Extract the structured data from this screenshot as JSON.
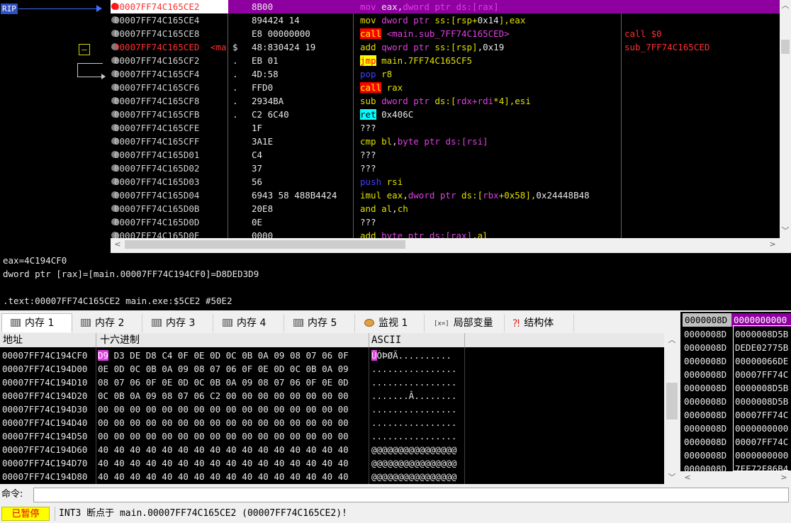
{
  "disasm": {
    "rip_label": "RIP",
    "jump_marker": "—",
    "rows": [
      {
        "addr": "00007FF74C165CE2",
        "label": "",
        "marker": "",
        "bytes": "8B00",
        "current": true,
        "bp": "red",
        "addr_red": true,
        "ins": [
          [
            "mov ",
            "op-mov"
          ],
          [
            "eax",
            "t-w"
          ],
          [
            ",",
            "t-w"
          ],
          [
            "dword ptr ",
            "t-p"
          ],
          [
            "ds:[rax]",
            "t-p"
          ]
        ],
        "comment": ""
      },
      {
        "addr": "00007FF74C165CE4",
        "label": "",
        "marker": "",
        "bytes": "894424 14",
        "current": false,
        "bp": "gray",
        "addr_red": false,
        "ins": [
          [
            "mov ",
            "op-y"
          ],
          [
            "dword ptr ",
            "t-p"
          ],
          [
            "ss:[rsp+",
            "t-y"
          ],
          [
            "0x14",
            "t-w"
          ],
          [
            "],",
            "t-y"
          ],
          [
            "eax",
            "t-y"
          ]
        ],
        "comment": ""
      },
      {
        "addr": "00007FF74C165CE8",
        "label": "",
        "marker": "",
        "bytes": "E8 00000000",
        "current": false,
        "bp": "gray",
        "addr_red": false,
        "ins": [
          [
            "call",
            "op-call"
          ],
          [
            " <main.sub_7FF74C165CED>",
            "t-p"
          ]
        ],
        "comment": "call $0"
      },
      {
        "addr": "00007FF74C165CED",
        "label": "<ma",
        "marker": "$",
        "bytes": "48:830424 19",
        "current": false,
        "bp": "gray",
        "addr_red": true,
        "ins": [
          [
            "add ",
            "op-y"
          ],
          [
            "qword ptr ",
            "t-p"
          ],
          [
            "ss:[rsp]",
            "t-y"
          ],
          [
            ",0x19",
            "t-w"
          ]
        ],
        "comment": "sub_7FF74C165CED"
      },
      {
        "addr": "00007FF74C165CF2",
        "label": "",
        "marker": ".",
        "bytes": "EB 01",
        "current": false,
        "bp": "gray",
        "addr_red": false,
        "ins": [
          [
            "jmp",
            "op-jmp"
          ],
          [
            " main.7FF74C165CF5",
            "t-y"
          ]
        ],
        "comment": ""
      },
      {
        "addr": "00007FF74C165CF4",
        "label": "",
        "marker": ".",
        "bytes": "4D:58",
        "current": false,
        "bp": "gray",
        "addr_red": false,
        "ins": [
          [
            "pop ",
            "op-push"
          ],
          [
            "r8",
            "t-y"
          ]
        ],
        "comment": ""
      },
      {
        "addr": "00007FF74C165CF6",
        "label": "",
        "marker": ".",
        "bytes": "FFD0",
        "current": false,
        "bp": "gray",
        "addr_red": false,
        "ins": [
          [
            "call",
            "op-call"
          ],
          [
            " rax",
            "t-y"
          ]
        ],
        "comment": ""
      },
      {
        "addr": "00007FF74C165CF8",
        "label": "",
        "marker": ".",
        "bytes": "2934BA",
        "current": false,
        "bp": "gray",
        "addr_red": false,
        "ins": [
          [
            "sub ",
            "op-y"
          ],
          [
            "dword ptr ",
            "t-p"
          ],
          [
            "ds:[",
            "t-y"
          ],
          [
            "rdx+rdi",
            "t-p"
          ],
          [
            "*4],",
            "t-y"
          ],
          [
            "esi",
            "t-y"
          ]
        ],
        "comment": ""
      },
      {
        "addr": "00007FF74C165CFB",
        "label": "",
        "marker": ".",
        "bytes": "C2 6C40",
        "current": false,
        "bp": "gray",
        "addr_red": false,
        "ins": [
          [
            "ret",
            "op-ret"
          ],
          [
            " 0x406C",
            "t-w"
          ]
        ],
        "comment": ""
      },
      {
        "addr": "00007FF74C165CFE",
        "label": "",
        "marker": "",
        "bytes": "1F",
        "current": false,
        "bp": "gray",
        "addr_red": false,
        "ins": [
          [
            "???",
            "t-w"
          ]
        ],
        "comment": ""
      },
      {
        "addr": "00007FF74C165CFF",
        "label": "",
        "marker": "",
        "bytes": "3A1E",
        "current": false,
        "bp": "gray",
        "addr_red": false,
        "ins": [
          [
            "cmp ",
            "op-y"
          ],
          [
            "bl",
            "t-y"
          ],
          [
            ",",
            "t-w"
          ],
          [
            "byte ptr ",
            "t-p"
          ],
          [
            "ds:[rsi]",
            "t-p"
          ]
        ],
        "comment": ""
      },
      {
        "addr": "00007FF74C165D01",
        "label": "",
        "marker": "",
        "bytes": "C4",
        "current": false,
        "bp": "gray",
        "addr_red": false,
        "ins": [
          [
            "???",
            "t-w"
          ]
        ],
        "comment": ""
      },
      {
        "addr": "00007FF74C165D02",
        "label": "",
        "marker": "",
        "bytes": "37",
        "current": false,
        "bp": "gray",
        "addr_red": false,
        "ins": [
          [
            "???",
            "t-w"
          ]
        ],
        "comment": ""
      },
      {
        "addr": "00007FF74C165D03",
        "label": "",
        "marker": "",
        "bytes": "56",
        "current": false,
        "bp": "gray",
        "addr_red": false,
        "ins": [
          [
            "push ",
            "op-push"
          ],
          [
            "rsi",
            "t-y"
          ]
        ],
        "comment": ""
      },
      {
        "addr": "00007FF74C165D04",
        "label": "",
        "marker": "",
        "bytes": "6943 58 488B4424",
        "current": false,
        "bp": "gray",
        "addr_red": false,
        "ins": [
          [
            "imul ",
            "op-y"
          ],
          [
            "eax",
            "t-y"
          ],
          [
            ",",
            "t-w"
          ],
          [
            "dword ptr ",
            "t-p"
          ],
          [
            "ds:[",
            "t-y"
          ],
          [
            "rbx",
            "t-p"
          ],
          [
            "+0x58],",
            "t-y"
          ],
          [
            "0x24448B48",
            "t-w"
          ]
        ],
        "comment": ""
      },
      {
        "addr": "00007FF74C165D0B",
        "label": "",
        "marker": "",
        "bytes": "20E8",
        "current": false,
        "bp": "gray",
        "addr_red": false,
        "ins": [
          [
            "and ",
            "op-y"
          ],
          [
            "al",
            "t-y"
          ],
          [
            ",",
            "t-w"
          ],
          [
            "ch",
            "t-y"
          ]
        ],
        "comment": ""
      },
      {
        "addr": "00007FF74C165D0D",
        "label": "",
        "marker": "",
        "bytes": "0E",
        "current": false,
        "bp": "gray",
        "addr_red": false,
        "ins": [
          [
            "???",
            "t-w"
          ]
        ],
        "comment": ""
      },
      {
        "addr": "00007FF74C165D0E",
        "label": "",
        "marker": "",
        "bytes": "0000",
        "current": false,
        "bp": "gray",
        "addr_red": false,
        "ins": [
          [
            "add ",
            "op-y"
          ],
          [
            "byte ptr ",
            "t-p"
          ],
          [
            "ds:[rax]",
            "t-p"
          ],
          [
            ",al",
            "t-y"
          ]
        ],
        "comment": ""
      }
    ]
  },
  "info": {
    "line1": "eax=4C194CF0",
    "line2": "dword ptr [rax]=[main.00007FF74C194CF0]=D8DED3D9",
    "line3": "",
    "line4": ".text:00007FF74C165CE2 main.exe:$5CE2 #50E2"
  },
  "tabs": [
    {
      "label": "内存 1",
      "icon": "memory",
      "active": true
    },
    {
      "label": "内存 2",
      "icon": "memory",
      "active": false
    },
    {
      "label": "内存 3",
      "icon": "memory",
      "active": false
    },
    {
      "label": "内存 4",
      "icon": "memory",
      "active": false
    },
    {
      "label": "内存 5",
      "icon": "memory",
      "active": false
    },
    {
      "label": "监视 1",
      "icon": "watch",
      "active": false
    },
    {
      "label": "局部变量",
      "icon": "var",
      "active": false
    },
    {
      "label": "结构体",
      "icon": "struct",
      "active": false
    }
  ],
  "var_icon_text": "[x=]",
  "dump": {
    "col_address": "地址",
    "col_hex": "十六进制",
    "col_ascii": "ASCII",
    "rows": [
      {
        "addr": "00007FF74C194CF0",
        "hex": [
          "D9",
          "D3 DE D8 C4 0F 0E 0D 0C 0B 0A 09 08 07 06 0F"
        ],
        "ascii": [
          "Ù",
          "ÓÞØÄ.........."
        ]
      },
      {
        "addr": "00007FF74C194D00",
        "hex": [
          "",
          "0E 0D 0C 0B 0A 09 08 07 06 0F 0E 0D 0C 0B 0A 09"
        ],
        "ascii": [
          "",
          "................"
        ]
      },
      {
        "addr": "00007FF74C194D10",
        "hex": [
          "",
          "08 07 06 0F 0E 0D 0C 0B 0A 09 08 07 06 0F 0E 0D"
        ],
        "ascii": [
          "",
          "................"
        ]
      },
      {
        "addr": "00007FF74C194D20",
        "hex": [
          "",
          "0C 0B 0A 09 08 07 06 C2 00 00 00 00 00 00 00 00"
        ],
        "ascii": [
          "",
          ".......Â........"
        ]
      },
      {
        "addr": "00007FF74C194D30",
        "hex": [
          "",
          "00 00 00 00 00 00 00 00 00 00 00 00 00 00 00 00"
        ],
        "ascii": [
          "",
          "................"
        ]
      },
      {
        "addr": "00007FF74C194D40",
        "hex": [
          "",
          "00 00 00 00 00 00 00 00 00 00 00 00 00 00 00 00"
        ],
        "ascii": [
          "",
          "................"
        ]
      },
      {
        "addr": "00007FF74C194D50",
        "hex": [
          "",
          "00 00 00 00 00 00 00 00 00 00 00 00 00 00 00 00"
        ],
        "ascii": [
          "",
          "................"
        ]
      },
      {
        "addr": "00007FF74C194D60",
        "hex": [
          "",
          "40 40 40 40 40 40 40 40 40 40 40 40 40 40 40 40"
        ],
        "ascii": [
          "",
          "@@@@@@@@@@@@@@@@"
        ]
      },
      {
        "addr": "00007FF74C194D70",
        "hex": [
          "",
          "40 40 40 40 40 40 40 40 40 40 40 40 40 40 40 40"
        ],
        "ascii": [
          "",
          "@@@@@@@@@@@@@@@@"
        ]
      },
      {
        "addr": "00007FF74C194D80",
        "hex": [
          "",
          "40 40 40 40 40 40 40 40 40 40 40 40 40 40 40 40"
        ],
        "ascii": [
          "",
          "@@@@@@@@@@@@@@@@"
        ]
      }
    ]
  },
  "stack": {
    "head_addr": "0000008D",
    "head_val": "0000000000",
    "rows": [
      {
        "a": "0000008D",
        "v": "0000008D5B"
      },
      {
        "a": "0000008D",
        "v": "DEDE02775B"
      },
      {
        "a": "0000008D",
        "v": "00000066DE"
      },
      {
        "a": "0000008D",
        "v": "00007FF74C"
      },
      {
        "a": "0000008D",
        "v": "0000008D5B"
      },
      {
        "a": "0000008D",
        "v": "0000008D5B"
      },
      {
        "a": "0000008D",
        "v": "00007FF74C"
      },
      {
        "a": "0000008D",
        "v": "0000000000"
      },
      {
        "a": "0000008D",
        "v": "00007FF74C"
      },
      {
        "a": "0000008D",
        "v": "0000000000"
      },
      {
        "a": "0000008D",
        "v": "7FF72F86B4"
      }
    ]
  },
  "command": {
    "label": "命令:",
    "value": ""
  },
  "status": {
    "paused": "已暂停",
    "message": "INT3 断点于 main.00007FF74C165CE2 (00007FF74C165CE2)!"
  }
}
